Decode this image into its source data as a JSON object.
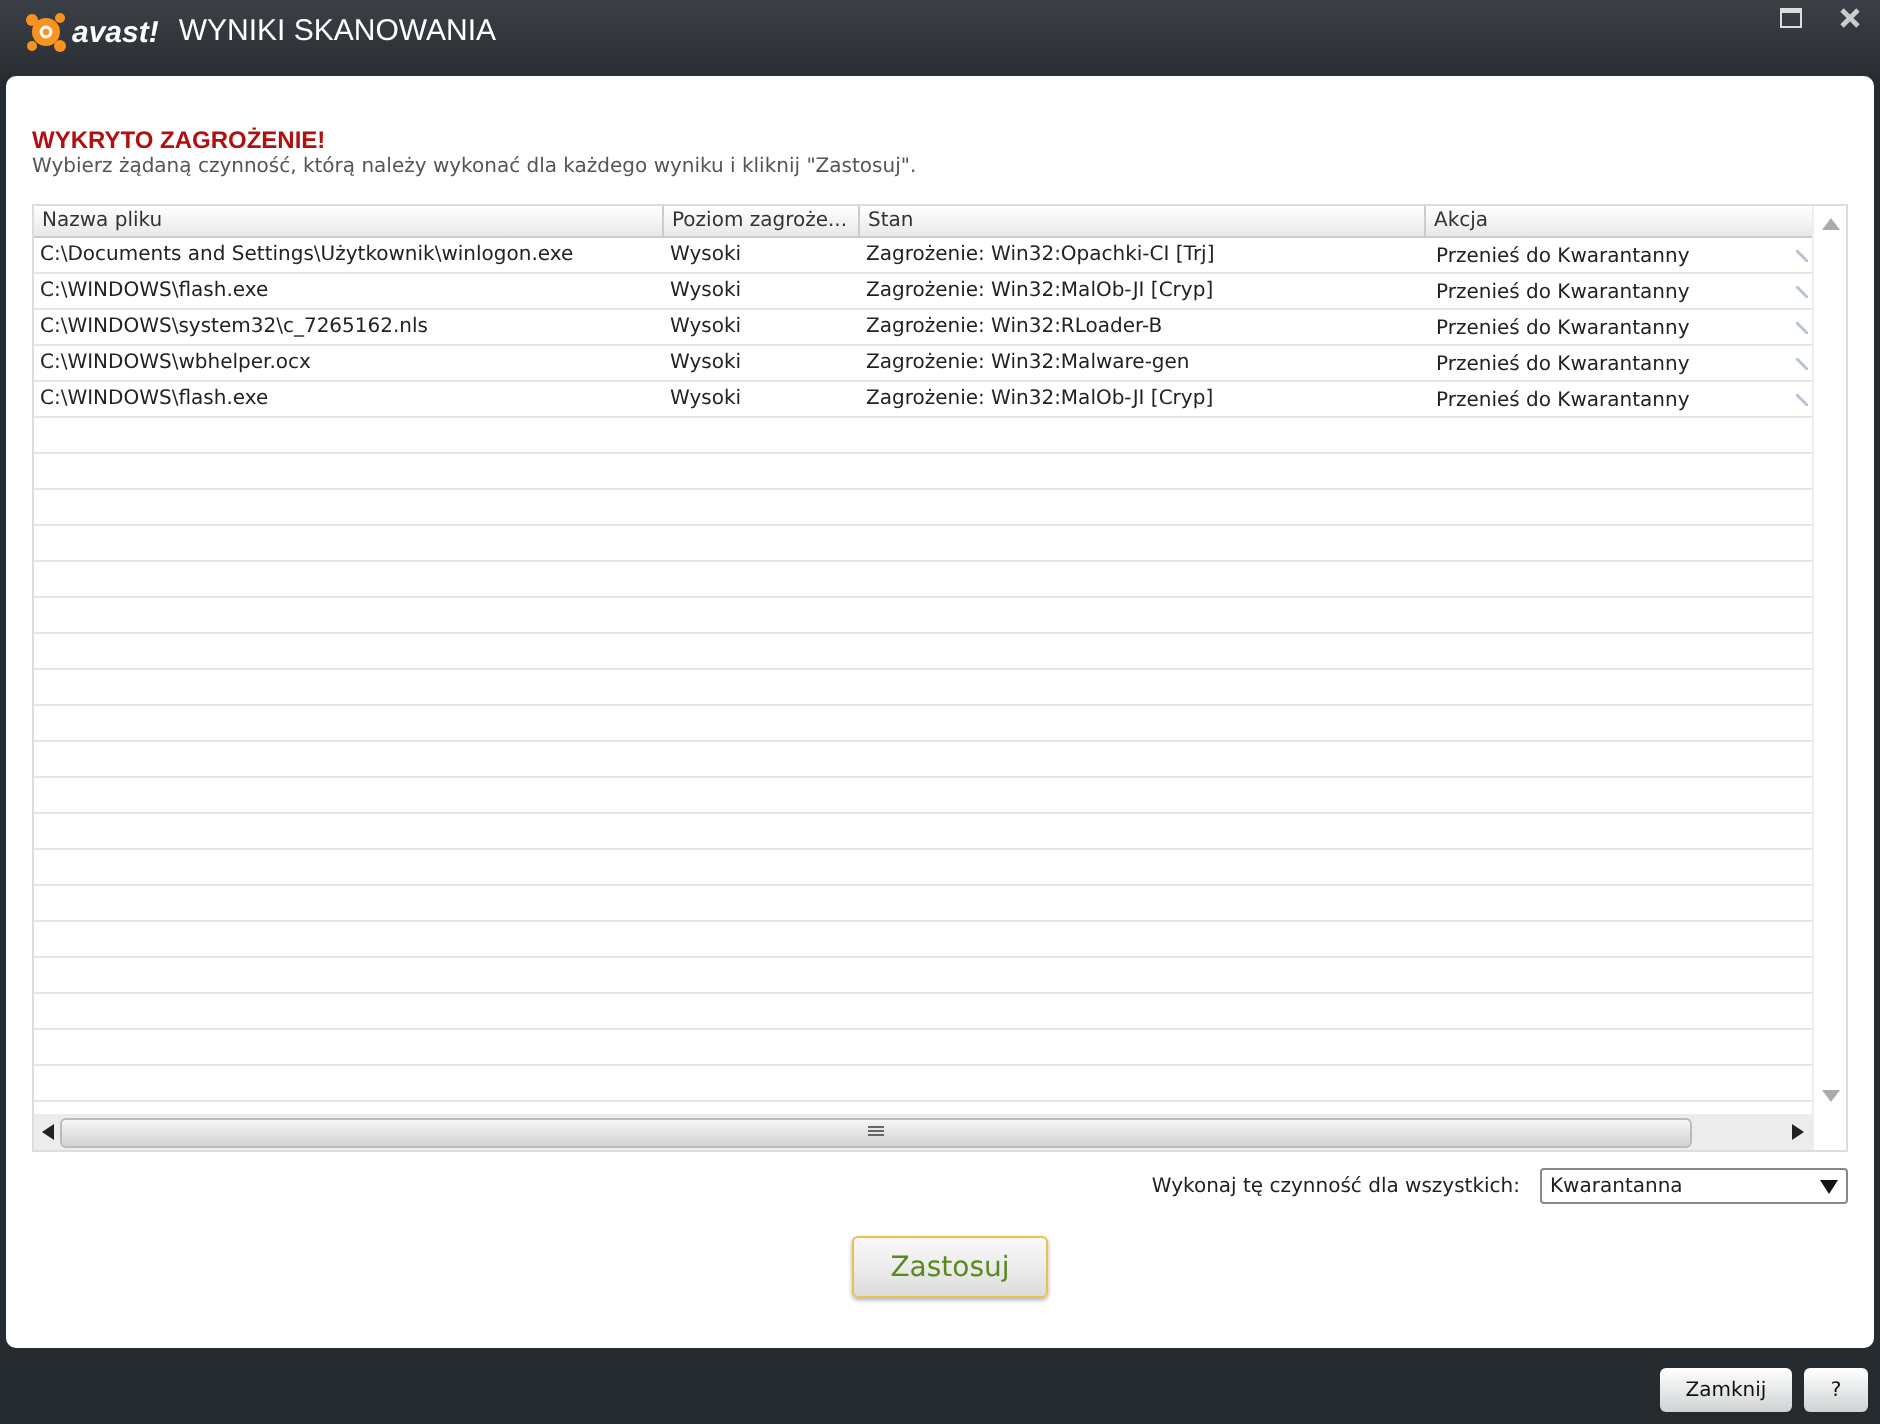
{
  "window": {
    "logo": "avast!",
    "title": "WYNIKI SKANOWANIA"
  },
  "heading": "WYKRYTO ZAGROŻENIE!",
  "instruction": "Wybierz żądaną czynność, którą należy wykonać dla każdego wyniku i kliknij \"Zastosuj\".",
  "table": {
    "columns": [
      "Nazwa pliku",
      "Poziom zagroże...",
      "Stan",
      "Akcja"
    ],
    "rows": [
      {
        "file": "C:\\Documents and Settings\\Użytkownik\\winlogon.exe",
        "level": "Wysoki",
        "status": "Zagrożenie: Win32:Opachki-CI [Trj]",
        "action": "Przenieś do Kwarantanny"
      },
      {
        "file": "C:\\WINDOWS\\flash.exe",
        "level": "Wysoki",
        "status": "Zagrożenie: Win32:MalOb-JI [Cryp]",
        "action": "Przenieś do Kwarantanny"
      },
      {
        "file": "C:\\WINDOWS\\system32\\c_7265162.nls",
        "level": "Wysoki",
        "status": "Zagrożenie: Win32:RLoader-B",
        "action": "Przenieś do Kwarantanny"
      },
      {
        "file": "C:\\WINDOWS\\wbhelper.ocx",
        "level": "Wysoki",
        "status": "Zagrożenie: Win32:Malware-gen",
        "action": "Przenieś do Kwarantanny"
      },
      {
        "file": "C:\\WINDOWS\\flash.exe",
        "level": "Wysoki",
        "status": "Zagrożenie: Win32:MalOb-JI [Cryp]",
        "action": "Przenieś do Kwarantanny"
      }
    ]
  },
  "apply_all": {
    "label": "Wykonaj tę czynność dla wszystkich:",
    "value": "Kwarantanna"
  },
  "apply_button": "Zastosuj",
  "footer_buttons": [
    "Zamknij",
    "?"
  ]
}
